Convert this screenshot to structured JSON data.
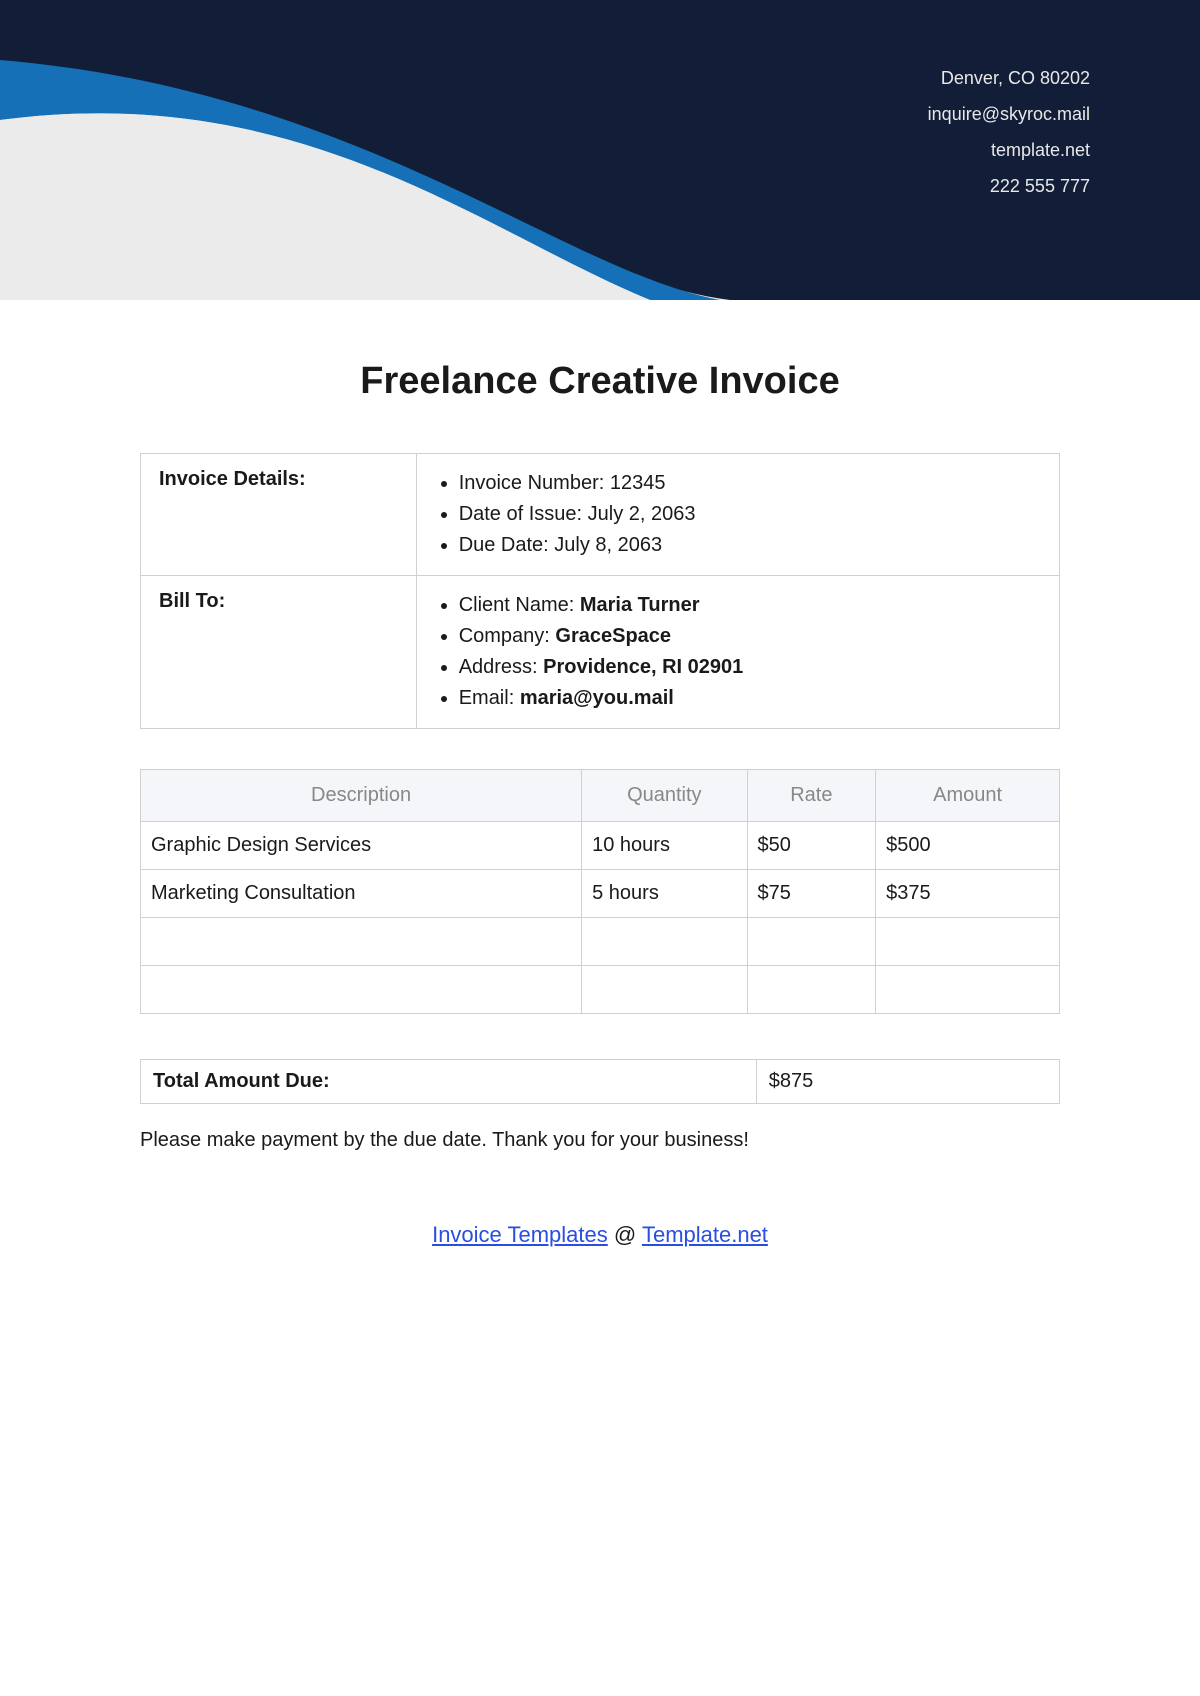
{
  "header": {
    "contact": [
      "Denver, CO 80202",
      "inquire@skyroc.mail",
      "template.net",
      "222 555 777"
    ]
  },
  "title": "Freelance Creative Invoice",
  "invoice_details": {
    "label": "Invoice Details:",
    "items": [
      {
        "label": "Invoice Number: ",
        "value": "12345"
      },
      {
        "label": "Date of Issue: ",
        "value": "July 2, 2063"
      },
      {
        "label": "Due Date: ",
        "value": "July 8, 2063"
      }
    ]
  },
  "bill_to": {
    "label": "Bill To:",
    "items": [
      {
        "label": "Client Name: ",
        "value": "Maria Turner"
      },
      {
        "label": "Company: ",
        "value": "GraceSpace"
      },
      {
        "label": "Address: ",
        "value": "Providence, RI 02901"
      },
      {
        "label": "Email: ",
        "value": "maria@you.mail"
      }
    ]
  },
  "line_items": {
    "headers": [
      "Description",
      "Quantity",
      "Rate",
      "Amount"
    ],
    "rows": [
      [
        "Graphic Design Services",
        "10 hours",
        "$50",
        "$500"
      ],
      [
        "Marketing Consultation",
        "5 hours",
        "$75",
        "$375"
      ],
      [
        "",
        "",
        "",
        ""
      ],
      [
        "",
        "",
        "",
        ""
      ]
    ]
  },
  "total": {
    "label": "Total Amount Due:",
    "value": "$875"
  },
  "note": "Please make payment by the due date. Thank you for your business!",
  "footer": {
    "link1": "Invoice Templates",
    "sep": " @ ",
    "link2": "Template.net"
  }
}
